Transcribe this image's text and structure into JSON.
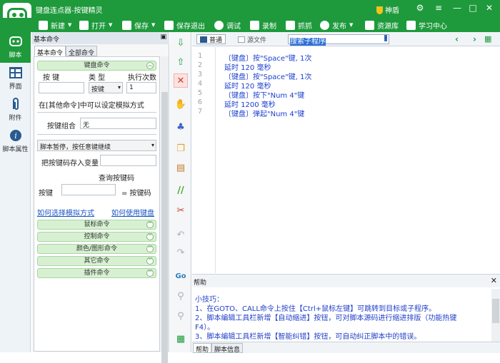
{
  "window": {
    "title": "键盘连点器-按键精灵",
    "shield_label": "神盾"
  },
  "toolbar": [
    {
      "label": "新建",
      "dropdown": true
    },
    {
      "label": "打开",
      "dropdown": true
    },
    {
      "label": "保存",
      "dropdown": true
    },
    {
      "label": "保存退出",
      "dropdown": false
    },
    {
      "label": "调试",
      "dropdown": false
    },
    {
      "label": "录制",
      "dropdown": false
    },
    {
      "label": "抓抓",
      "dropdown": false
    },
    {
      "label": "发布",
      "dropdown": true
    },
    {
      "label": "资源库",
      "dropdown": false
    },
    {
      "label": "学习中心",
      "dropdown": false
    }
  ],
  "leftnav": [
    {
      "label": "脚本",
      "icon": "robot-icon",
      "active": true
    },
    {
      "label": "界面",
      "icon": "layout-icon",
      "active": false
    },
    {
      "label": "附件",
      "icon": "paperclip-icon",
      "active": false
    },
    {
      "label": "脚本属性",
      "icon": "info-icon",
      "active": false
    }
  ],
  "panel": {
    "header": "基本命令",
    "tabs": [
      "基本命令",
      "全部命令"
    ],
    "keyboard_group": "键盘命令",
    "col_key": "按 键",
    "col_type": "类 型",
    "col_times": "执行次数",
    "type_value": "按键",
    "times_value": "1",
    "hint": "在[其他命令]中可以设定模拟方式",
    "combo_label": "按键组合",
    "combo_value": "无",
    "pause_option": "脚本暂停，按任意键继续",
    "store_label": "把按键码存入变量",
    "query_label": "查询按键码",
    "key_label": "按键",
    "equals_label": "= 按键码",
    "link_simulate": "如何选择模拟方式",
    "link_keyboard": "如何使用键盘",
    "groups": [
      "鼠标命令",
      "控制命令",
      "颜色/图形命令",
      "其它命令",
      "插件命令"
    ]
  },
  "editor": {
    "tabs": [
      "普通",
      "源文件"
    ],
    "find_value": "搜索子程序",
    "lines": [
      {
        "no": "1",
        "text": "〔键盘〕按\"Space\"键, 1次"
      },
      {
        "no": "2",
        "text": "延时 120 毫秒"
      },
      {
        "no": "3",
        "text": "〔键盘〕按\"Space\"键, 1次"
      },
      {
        "no": "4",
        "text": "延时 120 毫秒"
      },
      {
        "no": "5",
        "text": "〔键盘〕按下\"Num 4\"键"
      },
      {
        "no": "6",
        "text": "延时 1200 毫秒"
      },
      {
        "no": "7",
        "text": "〔键盘〕弹起\"Num 4\"键"
      }
    ]
  },
  "help": {
    "title": "帮助",
    "lines": [
      "小技巧：",
      "1、在GOTO、CALL命令上按住【Ctrl+鼠标左键】可跳转到目标或子程序。",
      "2、脚本编辑工具栏新增【自动缩进】按钮，可对脚本源码进行缩进排版（功能热键",
      "F4）。",
      "3、脚本编辑工具栏新增【智能纠错】按钮，可自动纠正脚本中的错误。"
    ],
    "tabs": [
      "帮助",
      "脚本信息"
    ]
  },
  "colors": {
    "brand": "#1e9a3c",
    "code": "#1a3fcf"
  }
}
